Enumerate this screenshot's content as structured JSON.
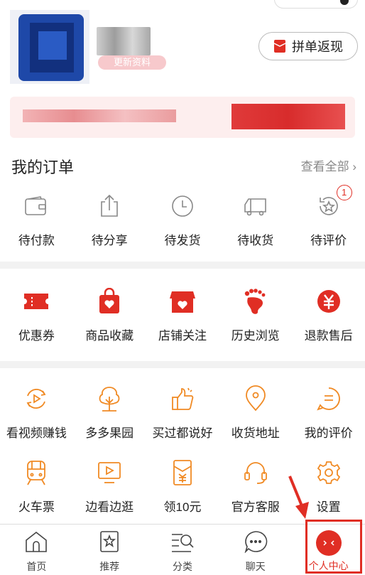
{
  "profile": {
    "update_label": "更新资料",
    "group_buy_label": "拼单返现"
  },
  "orders": {
    "title": "我的订单",
    "view_all": "查看全部",
    "items": [
      {
        "label": "待付款",
        "icon": "wallet-icon"
      },
      {
        "label": "待分享",
        "icon": "share-icon"
      },
      {
        "label": "待发货",
        "icon": "clock-icon"
      },
      {
        "label": "待收货",
        "icon": "truck-icon"
      },
      {
        "label": "待评价",
        "icon": "review-icon",
        "badge": "1"
      }
    ]
  },
  "features": [
    {
      "label": "优惠券",
      "icon": "coupon-icon"
    },
    {
      "label": "商品收藏",
      "icon": "favorite-goods-icon"
    },
    {
      "label": "店铺关注",
      "icon": "store-follow-icon"
    },
    {
      "label": "历史浏览",
      "icon": "footprint-icon"
    },
    {
      "label": "退款售后",
      "icon": "refund-icon"
    }
  ],
  "services_row1": [
    {
      "label": "看视频赚钱",
      "icon": "video-play-icon"
    },
    {
      "label": "多多果园",
      "icon": "tree-icon"
    },
    {
      "label": "买过都说好",
      "icon": "thumbs-up-icon"
    },
    {
      "label": "收货地址",
      "icon": "location-icon"
    },
    {
      "label": "我的评价",
      "icon": "comment-icon"
    }
  ],
  "services_row2": [
    {
      "label": "火车票",
      "icon": "train-icon"
    },
    {
      "label": "边看边逛",
      "icon": "tv-play-icon"
    },
    {
      "label": "领10元",
      "icon": "red-envelope-icon"
    },
    {
      "label": "官方客服",
      "icon": "headset-icon"
    },
    {
      "label": "设置",
      "icon": "settings-icon"
    }
  ],
  "nav": [
    {
      "label": "首页",
      "icon": "home-icon"
    },
    {
      "label": "推荐",
      "icon": "recommend-icon"
    },
    {
      "label": "分类",
      "icon": "category-search-icon"
    },
    {
      "label": "聊天",
      "icon": "chat-icon"
    },
    {
      "label": "个人中心",
      "icon": "profile-icon",
      "active": true
    }
  ],
  "colors": {
    "accent": "#e02e24",
    "highlight": "#e02e24"
  }
}
